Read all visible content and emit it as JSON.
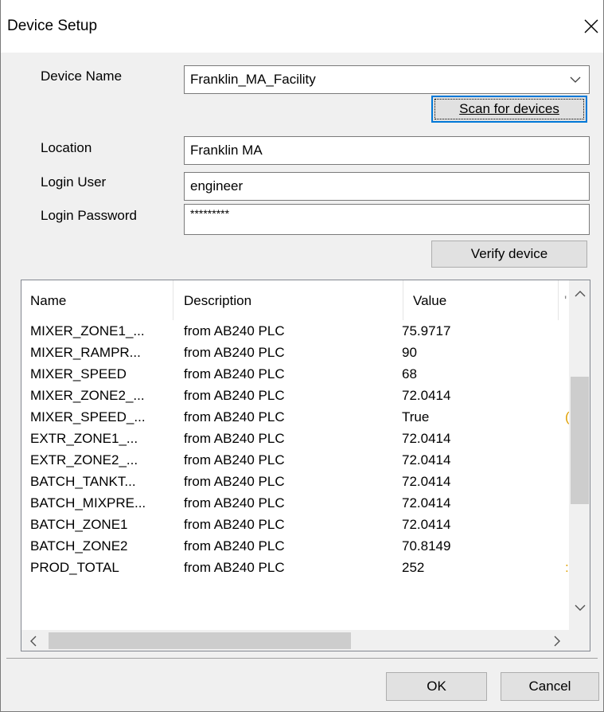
{
  "window": {
    "title": "Device Setup",
    "close_icon": "close-icon"
  },
  "form": {
    "device_name_label": "Device Name",
    "device_name_value": "Franklin_MA_Facility",
    "scan_button": "Scan for devices",
    "location_label": "Location",
    "location_value": "Franklin MA",
    "login_user_label": "Login User",
    "login_user_value": "engineer",
    "login_password_label": "Login Password",
    "login_password_value": "*********",
    "verify_button": "Verify device"
  },
  "table": {
    "columns": [
      "Name",
      "Description",
      "Value",
      "'"
    ],
    "rows": [
      {
        "name": "MIXER_ZONE1_...",
        "description": "from AB240 PLC",
        "value": "75.9717",
        "extra": ""
      },
      {
        "name": "MIXER_RAMPR...",
        "description": "from AB240 PLC",
        "value": "90",
        "extra": ""
      },
      {
        "name": "MIXER_SPEED",
        "description": "from AB240 PLC",
        "value": "68",
        "extra": ""
      },
      {
        "name": "MIXER_ZONE2_...",
        "description": "from AB240 PLC",
        "value": "72.0414",
        "extra": ""
      },
      {
        "name": "MIXER_SPEED_...",
        "description": "from AB240 PLC",
        "value": "True",
        "extra": "("
      },
      {
        "name": "EXTR_ZONE1_...",
        "description": "from AB240 PLC",
        "value": "72.0414",
        "extra": ""
      },
      {
        "name": "EXTR_ZONE2_...",
        "description": "from AB240 PLC",
        "value": "72.0414",
        "extra": ""
      },
      {
        "name": "BATCH_TANKT...",
        "description": "from AB240 PLC",
        "value": "72.0414",
        "extra": ""
      },
      {
        "name": "BATCH_MIXPRE...",
        "description": "from AB240 PLC",
        "value": "72.0414",
        "extra": ""
      },
      {
        "name": "BATCH_ZONE1",
        "description": "from AB240 PLC",
        "value": "72.0414",
        "extra": ""
      },
      {
        "name": "BATCH_ZONE2",
        "description": "from AB240 PLC",
        "value": "70.8149",
        "extra": ""
      },
      {
        "name": "PROD_TOTAL",
        "description": "from AB240 PLC",
        "value": "252",
        "extra": ":"
      }
    ]
  },
  "footer": {
    "ok_button": "OK",
    "cancel_button": "Cancel"
  }
}
